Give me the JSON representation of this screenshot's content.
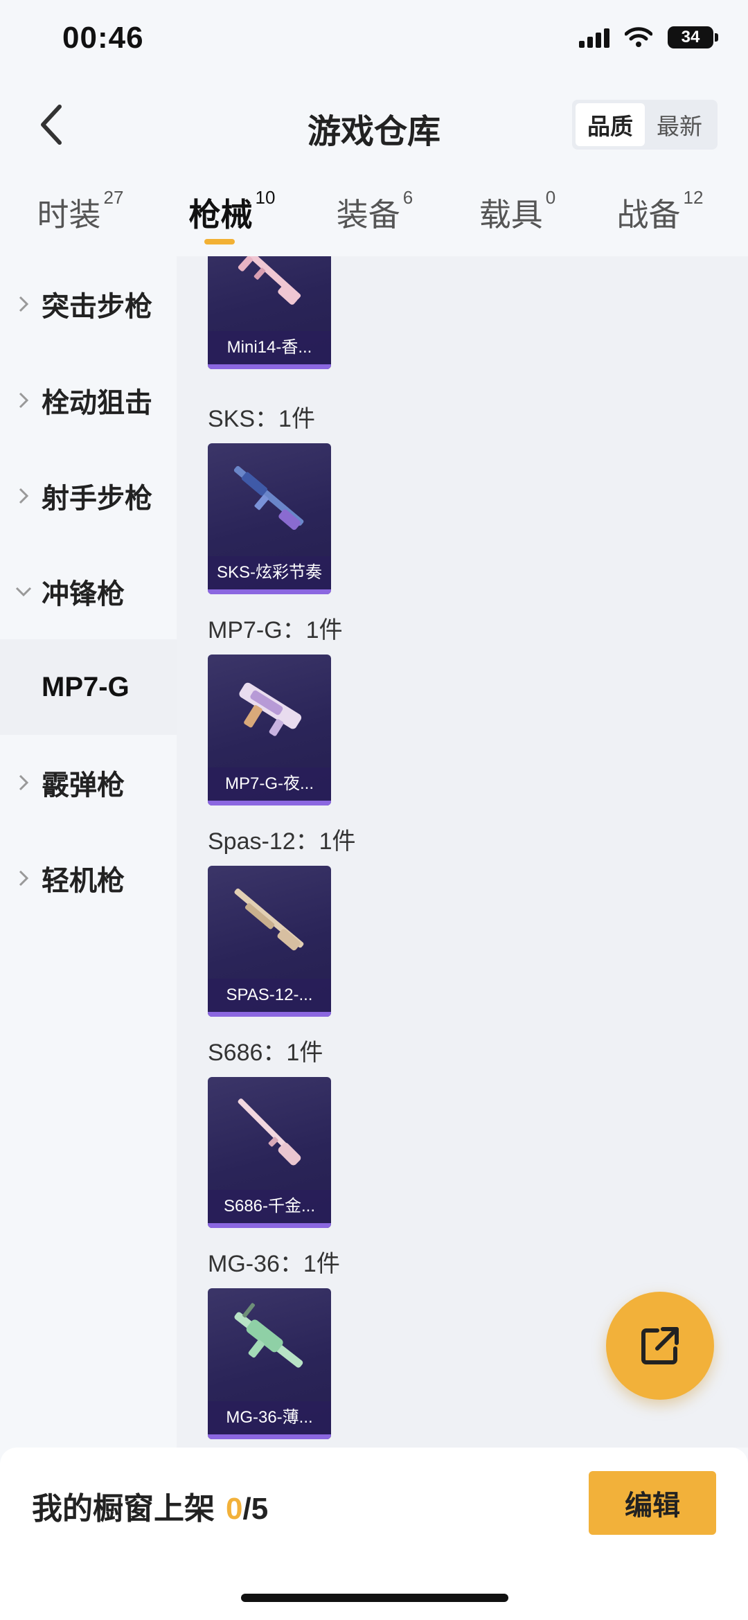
{
  "status_bar": {
    "time": "00:46",
    "battery": "34"
  },
  "header": {
    "title": "游戏仓库",
    "sort_options": [
      "品质",
      "最新"
    ]
  },
  "tabs": [
    {
      "label": "时装",
      "count": "27"
    },
    {
      "label": "枪械",
      "count": "10"
    },
    {
      "label": "装备",
      "count": "6"
    },
    {
      "label": "载具",
      "count": "0"
    },
    {
      "label": "战备",
      "count": "12"
    }
  ],
  "sidebar": {
    "categories": [
      "突击步枪",
      "栓动狙击",
      "射手步枪",
      "冲锋枪",
      "霰弹枪",
      "轻机枪"
    ],
    "selected_sub": "MP7-G"
  },
  "weapons": [
    {
      "title": "",
      "card": "Mini14-香..."
    },
    {
      "title": "SKS：1件",
      "card": "SKS-炫彩节奏"
    },
    {
      "title": "MP7-G：1件",
      "card": "MP7-G-夜..."
    },
    {
      "title": "Spas-12：1件",
      "card": "SPAS-12-..."
    },
    {
      "title": "S686：1件",
      "card": "S686-千金..."
    },
    {
      "title": "MG-36：1件",
      "card": "MG-36-薄..."
    }
  ],
  "bottom": {
    "showcase_label": "我的橱窗上架",
    "showcase_count": "0",
    "showcase_total": "/5",
    "edit_label": "编辑"
  },
  "colors": {
    "accent": "#f2b13a",
    "card_bg": "#2a2458",
    "card_stripe": "#8b67e0"
  }
}
